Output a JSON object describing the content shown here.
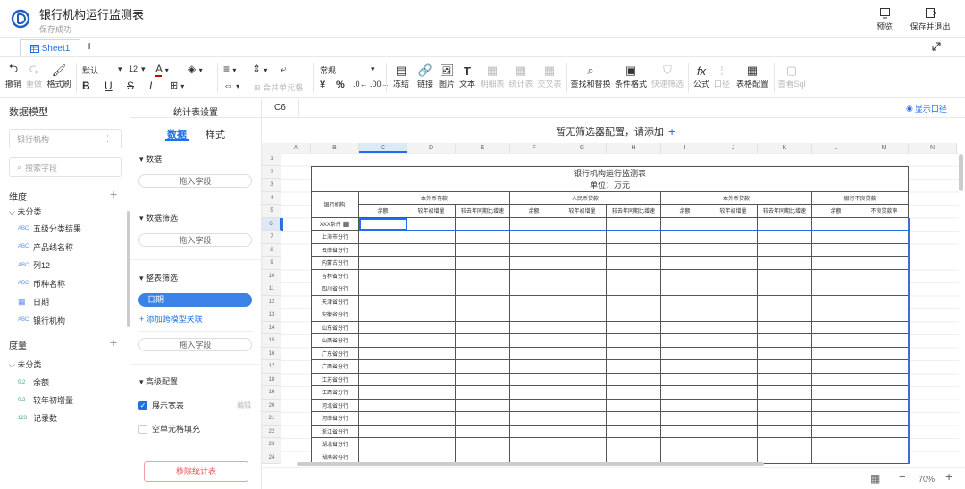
{
  "header": {
    "title": "银行机构运行监测表",
    "subtitle": "保存成功",
    "preview_label": "预览",
    "save_exit_label": "保存并退出"
  },
  "tabs": {
    "sheet_name": "Sheet1",
    "add": "+"
  },
  "toolbar": {
    "undo": "撤销",
    "redo": "重做",
    "format_brush": "格式刷",
    "font_name": "默认",
    "font_size": "12",
    "bold": "B",
    "underline": "U",
    "strike": "S",
    "italic": "I",
    "merge": "合并单元格",
    "number_format": "常规",
    "percent": "%",
    "currency": "¥",
    "freeze": "冻结",
    "link": "链接",
    "image": "图片",
    "text": "文本",
    "detail_table": "明细表",
    "stats_table": "统计表",
    "cross_table": "交叉表",
    "find_replace": "查找和替换",
    "conditional_format": "条件格式",
    "quick_filter": "快速筛选",
    "formula": "公式",
    "caliber": "口径",
    "table_config": "表格配置",
    "view_sql": "查看Sql"
  },
  "left_panel": {
    "title": "数据模型",
    "model_select": "银行机构",
    "search_placeholder": "搜索字段",
    "dimensions_label": "维度",
    "dim_group": "未分类",
    "dimension_fields": [
      {
        "type": "ABC",
        "name": "五级分类结果"
      },
      {
        "type": "ABC",
        "name": "产品线名称"
      },
      {
        "type": "ABC",
        "name": "列12"
      },
      {
        "type": "ABC",
        "name": "币种名称"
      },
      {
        "type": "date",
        "name": "日期"
      },
      {
        "type": "ABC",
        "name": "银行机构"
      }
    ],
    "measures_label": "度量",
    "measure_group": "未分类",
    "measure_fields": [
      {
        "type": "0.2",
        "name": "余额"
      },
      {
        "type": "0.2",
        "name": "较年初增量"
      },
      {
        "type": "123",
        "name": "记录数"
      }
    ]
  },
  "mid_panel": {
    "title": "统计表设置",
    "tab_data": "数据",
    "tab_style": "样式",
    "section_data": "数据",
    "drag_field": "拖入字段",
    "section_data_filter": "数据筛选",
    "section_table_filter": "整表筛选",
    "filter_chip": "日期",
    "add_cross_model": "添加跨模型关联",
    "section_advanced": "高级配置",
    "show_wide_table": "展示宽表",
    "edit": "编辑",
    "empty_fill": "空单元格填充",
    "remove_button": "移除统计表"
  },
  "sheet": {
    "cell_ref": "C6",
    "show_caliber": "显示口径",
    "filter_notice": "暂无筛选器配置，请添加",
    "columns": [
      "A",
      "B",
      "C",
      "D",
      "E",
      "F",
      "G",
      "H",
      "I",
      "J",
      "K",
      "L",
      "M",
      "N"
    ],
    "rows": [
      "1",
      "2",
      "3",
      "4",
      "5",
      "6",
      "7",
      "8",
      "9",
      "10",
      "11",
      "12",
      "13",
      "14",
      "15",
      "16",
      "17",
      "18",
      "19",
      "20",
      "21",
      "22",
      "23",
      "24"
    ],
    "table_title": "银行机构运行监测表",
    "table_unit": "单位：万元",
    "org_header": "银行机构",
    "groups": [
      "本外币存款",
      "人民币贷款",
      "本外币贷款",
      "银行不良贷款"
    ],
    "sub_headers": [
      "余额",
      "较年初增量",
      "较去年同期比增速",
      "余额",
      "较年初增量",
      "较去年同期比增速",
      "余额",
      "较年初增量",
      "较去年同期比增速",
      "余额",
      "不良贷款率"
    ],
    "org_first": "XXX条件",
    "orgs": [
      "上海市分行",
      "云南省分行",
      "内蒙古分行",
      "吉林省分行",
      "四川省分行",
      "天津省分行",
      "安徽省分行",
      "山东省分行",
      "山西省分行",
      "广东省分行",
      "广西省分行",
      "江苏省分行",
      "江西省分行",
      "河北省分行",
      "河南省分行",
      "浙江省分行",
      "湖北省分行",
      "湖南省分行"
    ],
    "zoom": "70%"
  }
}
